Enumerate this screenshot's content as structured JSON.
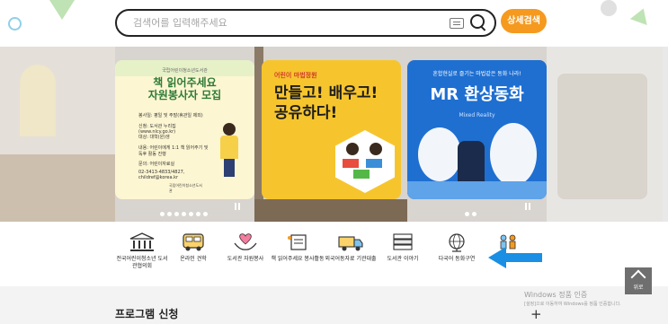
{
  "search": {
    "placeholder": "검색어를 입력해주세요",
    "advanced_label": "상세검색"
  },
  "banner": {
    "card1": {
      "sub": "국립어린이청소년도서관",
      "title_1": "책 읽어주세요",
      "title_2": "자원봉사자 모집",
      "lines": [
        "봉사일: 평일 및 주말(휴관일 제외)",
        "신청: 도서관 누리집(www.nlcy.go.kr)",
        "대상: 대학(원)생",
        "내용: 어린이에게 1:1 책 읽어주기 및 독후 활동 진행",
        "문의: 어린이자료실",
        "02-3413-4833/4827, childref@korea.kr"
      ],
      "logo": "국립어린이청소년도서관"
    },
    "card2": {
      "logo": "어린이 마법정원",
      "title_1": "만들고! 배우고!",
      "title_2": "공유하다!"
    },
    "card3": {
      "top": "혼합현실로 즐기는 마법같은 동화 나라!",
      "title": "MR 환상동화",
      "sub": "Mixed Reality"
    }
  },
  "menu": [
    {
      "label": "전국어린이청소년 도서관협의회",
      "icon": "library-building-icon"
    },
    {
      "label": "온라인 견학",
      "icon": "bus-icon"
    },
    {
      "label": "도서관 자원봉사",
      "icon": "heart-hands-icon"
    },
    {
      "label": "책 읽어주세요 봉사활동",
      "icon": "book-reading-icon"
    },
    {
      "label": "외국어동자료 기관대출",
      "icon": "delivery-truck-icon"
    },
    {
      "label": "도서관 이야기",
      "icon": "book-stack-icon"
    },
    {
      "label": "다국어 동화구연",
      "icon": "globe-icon"
    },
    {
      "label": "",
      "icon": "people-icon"
    }
  ],
  "section": {
    "program_title": "프로그램 신청",
    "plus": "+"
  },
  "top_button": "위로",
  "windows": {
    "line1": "Windows 정품 인증",
    "line2": "[설정]으로 이동하여 Windows를 정품 인증합니다."
  },
  "colors": {
    "accent": "#f59a1f",
    "card3_bg": "#1f6fd1",
    "card2_bg": "#f6c52e"
  }
}
